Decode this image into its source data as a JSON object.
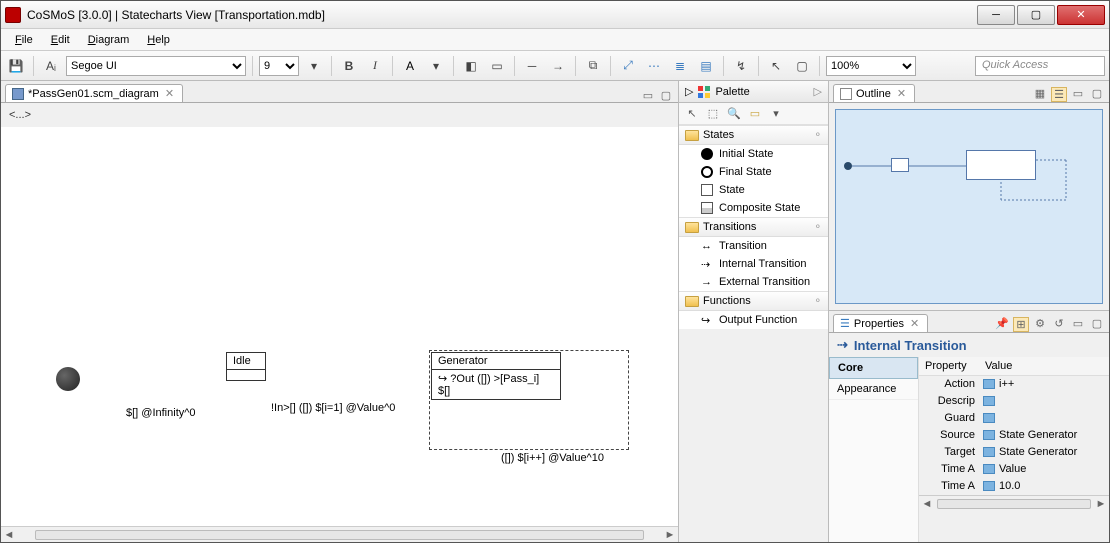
{
  "window": {
    "title": "CoSMoS [3.0.0] | Statecharts View [Transportation.mdb]"
  },
  "menu": {
    "file": "File",
    "edit": "Edit",
    "diagram": "Diagram",
    "help": "Help"
  },
  "toolbar": {
    "font": "Segoe UI",
    "size": "9",
    "zoom": "100%",
    "quick_access_placeholder": "Quick Access"
  },
  "editor": {
    "tab_label": "*PassGen01.scm_diagram",
    "breadcrumb": "<...>",
    "states": {
      "idle": "Idle",
      "generator": "Generator",
      "gen_body": "↪ ?Out ([]) >[Pass_i] $[]"
    },
    "labels": {
      "init_to_idle": "$[] @Infinity^0",
      "idle_to_gen": "!In>[] ([]) $[i=1] @Value^0",
      "gen_internal": "([]) $[i++] @Value^10"
    }
  },
  "palette": {
    "title": "Palette",
    "drawers": {
      "states": "States",
      "transitions": "Transitions",
      "functions": "Functions"
    },
    "items": {
      "initial_state": "Initial State",
      "final_state": "Final State",
      "state": "State",
      "composite_state": "Composite State",
      "transition": "Transition",
      "internal_transition": "Internal Transition",
      "external_transition": "External Transition",
      "output_function": "Output Function"
    }
  },
  "outline": {
    "title": "Outline"
  },
  "properties": {
    "title": "Properties",
    "heading": "Internal Transition",
    "cats": {
      "core": "Core",
      "appearance": "Appearance"
    },
    "cols": {
      "prop": "Property",
      "val": "Value"
    },
    "rows": {
      "action": {
        "name": "Action",
        "value": "i++"
      },
      "descrip": {
        "name": "Descrip",
        "value": ""
      },
      "guard": {
        "name": "Guard",
        "value": ""
      },
      "source": {
        "name": "Source",
        "value": "State Generator"
      },
      "target": {
        "name": "Target",
        "value": "State Generator"
      },
      "time_a1": {
        "name": "Time A",
        "value": "Value"
      },
      "time_a2": {
        "name": "Time A",
        "value": "10.0"
      }
    }
  }
}
